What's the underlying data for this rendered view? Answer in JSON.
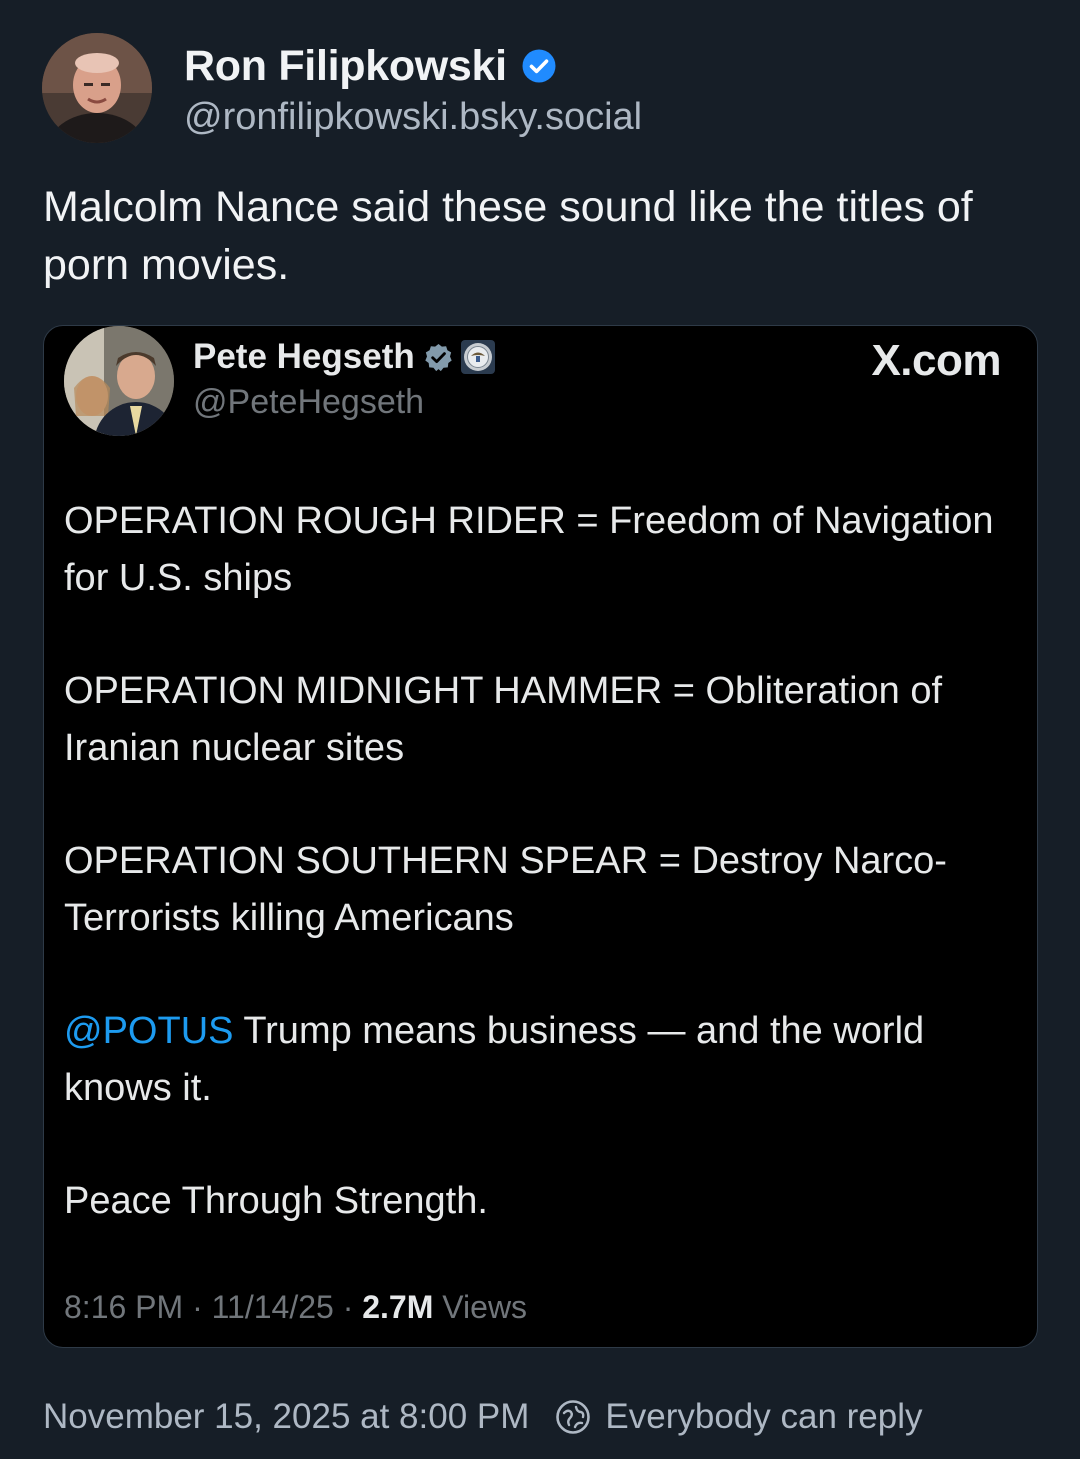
{
  "post": {
    "author_name": "Ron Filipkowski",
    "author_handle": "@ronfilipkowski.bsky.social",
    "text": "Malcolm Nance said these sound like the titles of porn movies.",
    "timestamp": "November 15, 2025 at 8:00 PM",
    "reply_setting": "Everybody can reply"
  },
  "embed": {
    "author_name": "Pete Hegseth",
    "author_handle": "@PeteHegseth",
    "source": "X.com",
    "paragraphs": [
      "OPERATION ROUGH RIDER = Freedom of Navigation for U.S. ships",
      "OPERATION MIDNIGHT HAMMER = Obliteration of Iranian nuclear sites",
      "OPERATION SOUTHERN SPEAR = Destroy Narco-Terrorists killing Americans"
    ],
    "mention": "@POTUS",
    "mention_rest": " Trump means business — and the world knows it.",
    "closing": "Peace Through Strength.",
    "time": "8:16 PM",
    "date": "11/14/25",
    "separator": " · ",
    "views_count": "2.7M",
    "views_label": "Views"
  },
  "colors": {
    "background": "#161e27",
    "verified_blue": "#208bfe",
    "mention_blue": "#1d9bf0",
    "muted_text": "#aeb8c4"
  },
  "icons": {
    "verified": "verified-badge-icon",
    "seal": "government-seal-icon",
    "reply": "everybody-can-reply-icon"
  }
}
